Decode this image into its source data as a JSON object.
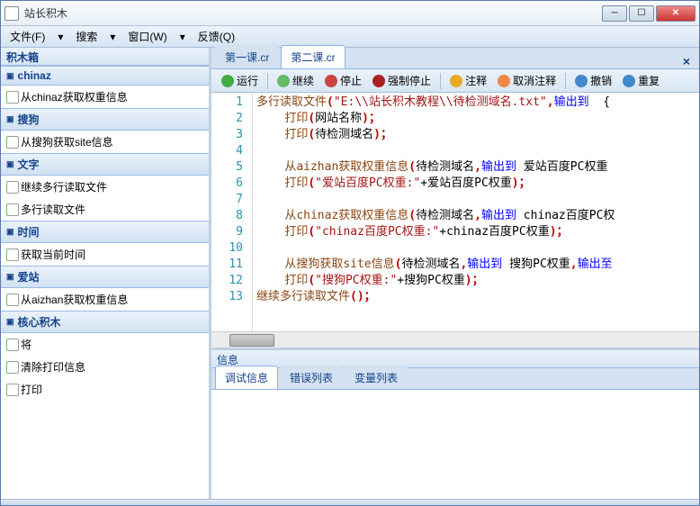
{
  "window": {
    "title": "站长积木"
  },
  "menu": {
    "file": "文件(F)",
    "search": "搜索",
    "window": "窗口(W)",
    "feedback": "反馈(Q)"
  },
  "sidebar": {
    "title": "积木箱",
    "cats": [
      {
        "name": "chinaz",
        "items": [
          "从chinaz获取权重信息"
        ]
      },
      {
        "name": "搜狗",
        "items": [
          "从搜狗获取site信息"
        ]
      },
      {
        "name": "文字",
        "items": [
          "继续多行读取文件",
          "多行读取文件"
        ]
      },
      {
        "name": "时间",
        "items": [
          "获取当前时间"
        ]
      },
      {
        "name": "爱站",
        "items": [
          "从aizhan获取权重信息"
        ]
      },
      {
        "name": "核心积木",
        "items": [
          "将",
          "清除打印信息",
          "打印"
        ]
      }
    ]
  },
  "tabs": [
    {
      "label": "第一课.cr"
    },
    {
      "label": "第二课.cr"
    }
  ],
  "toolbar": {
    "run": "运行",
    "continue": "继续",
    "stop": "停止",
    "forceStop": "强制停止",
    "comment": "注释",
    "uncomment": "取消注释",
    "undo": "撤销",
    "redo": "重复"
  },
  "code": {
    "lines": [
      {
        "n": 1,
        "seg": [
          [
            "func",
            "多行读取文件"
          ],
          [
            "punct",
            "("
          ],
          [
            "str",
            "\"E:\\\\站长积木教程\\\\待检测域名.txt\""
          ],
          [
            "punct",
            ","
          ],
          [
            "kw",
            "输出到"
          ],
          [
            "plain",
            "  {"
          ]
        ]
      },
      {
        "n": 2,
        "seg": [
          [
            "plain",
            "    "
          ],
          [
            "func",
            "打印"
          ],
          [
            "punct",
            "("
          ],
          [
            "plain",
            "网站名称"
          ],
          [
            "punct",
            ")；"
          ]
        ]
      },
      {
        "n": 3,
        "seg": [
          [
            "plain",
            "    "
          ],
          [
            "func",
            "打印"
          ],
          [
            "punct",
            "("
          ],
          [
            "plain",
            "待检测域名"
          ],
          [
            "punct",
            ")；"
          ]
        ]
      },
      {
        "n": 4,
        "seg": []
      },
      {
        "n": 5,
        "seg": [
          [
            "plain",
            "    "
          ],
          [
            "func",
            "从aizhan获取权重信息"
          ],
          [
            "punct",
            "("
          ],
          [
            "plain",
            "待检测域名"
          ],
          [
            "punct",
            ","
          ],
          [
            "kw",
            "输出到"
          ],
          [
            "plain",
            " 爱站百度PC权重"
          ]
        ]
      },
      {
        "n": 6,
        "seg": [
          [
            "plain",
            "    "
          ],
          [
            "func",
            "打印"
          ],
          [
            "punct",
            "("
          ],
          [
            "str",
            "\"爱站百度PC权重:\""
          ],
          [
            "plain",
            "+爱站百度PC权重"
          ],
          [
            "punct",
            ")；"
          ]
        ]
      },
      {
        "n": 7,
        "seg": []
      },
      {
        "n": 8,
        "seg": [
          [
            "plain",
            "    "
          ],
          [
            "func",
            "从chinaz获取权重信息"
          ],
          [
            "punct",
            "("
          ],
          [
            "plain",
            "待检测域名"
          ],
          [
            "punct",
            ","
          ],
          [
            "kw",
            "输出到"
          ],
          [
            "plain",
            " chinaz百度PC权"
          ]
        ]
      },
      {
        "n": 9,
        "seg": [
          [
            "plain",
            "    "
          ],
          [
            "func",
            "打印"
          ],
          [
            "punct",
            "("
          ],
          [
            "str",
            "\"chinaz百度PC权重:\""
          ],
          [
            "plain",
            "+chinaz百度PC权重"
          ],
          [
            "punct",
            ")；"
          ]
        ]
      },
      {
        "n": 10,
        "seg": []
      },
      {
        "n": 11,
        "seg": [
          [
            "plain",
            "    "
          ],
          [
            "func",
            "从搜狗获取site信息"
          ],
          [
            "punct",
            "("
          ],
          [
            "plain",
            "待检测域名"
          ],
          [
            "punct",
            ","
          ],
          [
            "kw",
            "输出到"
          ],
          [
            "plain",
            " 搜狗PC权重"
          ],
          [
            "punct",
            ","
          ],
          [
            "kw",
            "输出至"
          ]
        ]
      },
      {
        "n": 12,
        "seg": [
          [
            "plain",
            "    "
          ],
          [
            "func",
            "打印"
          ],
          [
            "punct",
            "("
          ],
          [
            "str",
            "\"搜狗PC权重:\""
          ],
          [
            "plain",
            "+搜狗PC权重"
          ],
          [
            "punct",
            ")；"
          ]
        ]
      },
      {
        "n": 13,
        "seg": [
          [
            "func",
            "继续多行读取文件"
          ],
          [
            "punct",
            "()；"
          ]
        ]
      }
    ]
  },
  "bottomPanel": {
    "title": "信息",
    "tabs": [
      "调试信息",
      "错误列表",
      "变量列表"
    ]
  }
}
